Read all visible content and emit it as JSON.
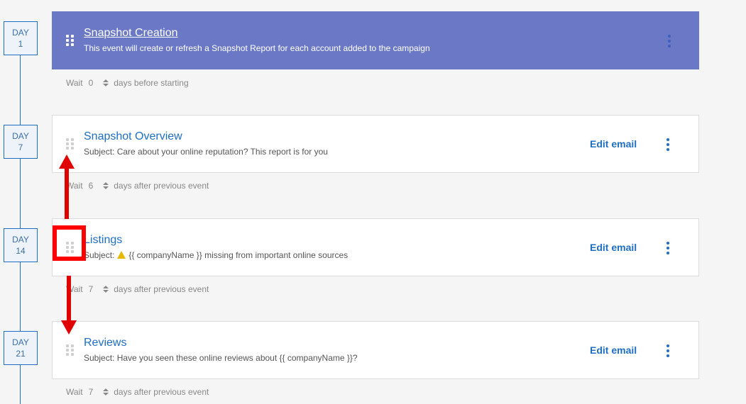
{
  "events": [
    {
      "day_label": "DAY",
      "day_number": "1",
      "title": "Snapshot Creation",
      "subtitle": "This event will create or refresh a Snapshot Report for each account added to the campaign",
      "edit_label": "",
      "wait": {
        "label": "Wait",
        "value": "0",
        "suffix": "days before starting"
      }
    },
    {
      "day_label": "DAY",
      "day_number": "7",
      "title": "Snapshot Overview",
      "subtitle": "Subject: Care about your online reputation? This report is for you",
      "edit_label": "Edit email",
      "wait": {
        "label": "Wait",
        "value": "6",
        "suffix": "days after previous event"
      }
    },
    {
      "day_label": "DAY",
      "day_number": "14",
      "title": "Listings",
      "subtitle_prefix": "Subject:",
      "subtitle": "{{ companyName }} missing from important online sources",
      "edit_label": "Edit email",
      "wait": {
        "label": "Wait",
        "value": "7",
        "suffix": "days after previous event"
      }
    },
    {
      "day_label": "DAY",
      "day_number": "21",
      "title": "Reviews",
      "subtitle": "Subject: Have you seen these online reviews about {{ companyName }}?",
      "edit_label": "Edit email",
      "wait": {
        "label": "Wait",
        "value": "7",
        "suffix": "days after previous event"
      }
    }
  ],
  "colors": {
    "accent": "#1e6fc4",
    "primary_card": "#6b78c6",
    "annotation": "#e00000",
    "warning": "#e6b800"
  },
  "icons": [
    "drag-handle-icon",
    "more-vertical-icon",
    "stepper-icon",
    "warning-icon"
  ]
}
